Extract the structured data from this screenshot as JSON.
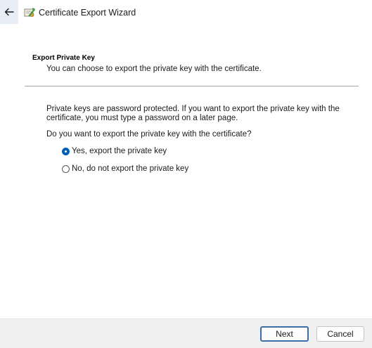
{
  "window": {
    "title": "Certificate Export Wizard",
    "back_icon": "arrow-left-icon",
    "app_icon": "certificate-icon"
  },
  "page": {
    "title": "Export Private Key",
    "subtitle": "You can choose to export the private key with the certificate.",
    "info": "Private keys are password protected. If you want to export the private key with the certificate, you must type a password on a later page.",
    "question": "Do you want to export the private key with the certificate?"
  },
  "options": [
    {
      "label": "Yes, export the private key",
      "selected": true
    },
    {
      "label": "No, do not export the private key",
      "selected": false
    }
  ],
  "footer": {
    "next_label": "Next",
    "cancel_label": "Cancel"
  },
  "colors": {
    "accent": "#005fb8",
    "footer_bg": "#f0f0f0"
  }
}
